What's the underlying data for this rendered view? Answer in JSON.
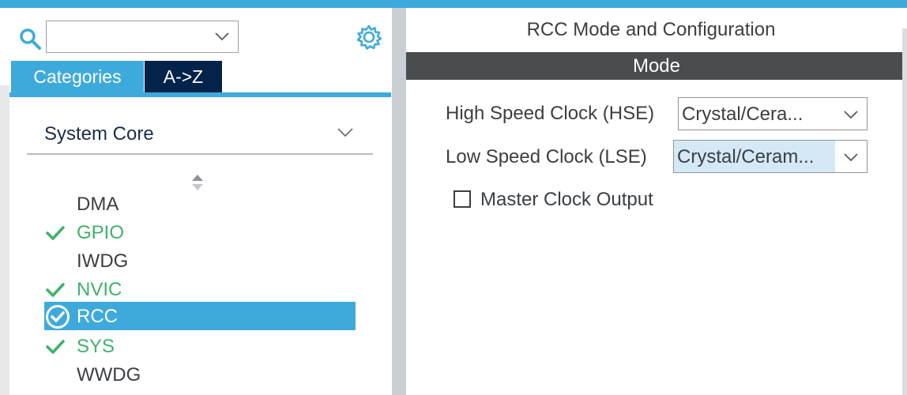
{
  "colors": {
    "accent": "#3eaadc",
    "tab_dark": "#03234b",
    "ok_green": "#3fb26b",
    "mode_bar": "#4a4d50"
  },
  "left": {
    "search": {
      "value": "",
      "icon": "search-icon",
      "dropdown_icon": "chevron-down-icon"
    },
    "settings_icon": "gear-icon",
    "tabs": [
      {
        "label": "Categories",
        "active": true
      },
      {
        "label": "A->Z",
        "active": false
      }
    ],
    "group": {
      "label": "System Core",
      "icon": "chevron-down-icon"
    },
    "sort_icon": "sort-arrows-icon",
    "items": [
      {
        "label": "DMA",
        "status": "none"
      },
      {
        "label": "GPIO",
        "status": "ok"
      },
      {
        "label": "IWDG",
        "status": "none"
      },
      {
        "label": "NVIC",
        "status": "ok"
      },
      {
        "label": "RCC",
        "status": "selected"
      },
      {
        "label": "SYS",
        "status": "ok"
      },
      {
        "label": "WWDG",
        "status": "none"
      }
    ]
  },
  "right": {
    "title": "RCC Mode and Configuration",
    "section": "Mode",
    "hse": {
      "label": "High Speed Clock (HSE)",
      "value": "Crystal/Cera..."
    },
    "lse": {
      "label": "Low Speed Clock (LSE)",
      "value": "Crystal/Ceram..."
    },
    "mco": {
      "label": "Master Clock Output",
      "checked": false
    }
  }
}
